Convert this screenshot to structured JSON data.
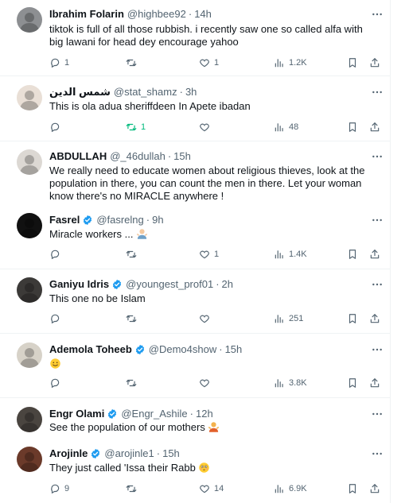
{
  "tweets": [
    {
      "name": "Ibrahim Folarin",
      "handle": "@highbee92",
      "time": "14h",
      "verified": false,
      "text": "tiktok is full of all those rubbish. i recently saw one so called alfa with big lawani for head dey encourage yahoo",
      "replies": "1",
      "retweets": "",
      "likes": "1",
      "views": "1.2K",
      "avatar_color": "#8d8f92"
    },
    {
      "name": "شمس الدين",
      "handle": "@stat_shamz",
      "time": "3h",
      "verified": false,
      "text": "This is ola adua sheriffdeen  In Apete ibadan",
      "replies": "",
      "retweets": "1",
      "likes": "",
      "views": "48",
      "avatar_color": "#e9dfd6"
    },
    {
      "name": "ABDULLAH",
      "handle": "@_46dullah",
      "time": "15h",
      "verified": false,
      "text": "We really need to educate women about religious thieves, look at the population in there, you can count the men in there. Let your woman know there's no MIRACLE anywhere !",
      "replies": "",
      "retweets": "",
      "likes": "",
      "views": "",
      "avatar_color": "#dcd8d3"
    },
    {
      "name": "Fasrel",
      "handle": "@fasrelng",
      "time": "9h",
      "verified": true,
      "text": "Miracle workers ... ",
      "emoji": "person-shrugging",
      "replies": "",
      "retweets": "",
      "likes": "1",
      "views": "1.4K",
      "avatar_color": "#111111"
    },
    {
      "name": "Ganiyu Idris",
      "handle": "@youngest_prof01",
      "time": "2h",
      "verified": true,
      "text": "This one no be Islam",
      "replies": "",
      "retweets": "",
      "likes": "",
      "views": "251",
      "avatar_color": "#3c3a38"
    },
    {
      "name": "Ademola Toheeb",
      "handle": "@Demo4show",
      "time": "15h",
      "verified": true,
      "text": "",
      "emoji": "smiling-face",
      "replies": "",
      "retweets": "",
      "likes": "",
      "views": "3.8K",
      "avatar_color": "#d7d2c8"
    },
    {
      "name": "Engr Olami",
      "handle": "@Engr_Ashile",
      "time": "12h",
      "verified": true,
      "text": "See the population of our mothers ",
      "emoji": "person-shrugging-orange",
      "replies": "",
      "retweets": "",
      "likes": "",
      "views": "",
      "avatar_color": "#4a4540"
    },
    {
      "name": "Arojinle",
      "handle": "@arojinle1",
      "time": "15h",
      "verified": true,
      "text": "They just called 'Issa their Rabb ",
      "emoji": "flushed-face",
      "replies": "9",
      "retweets": "",
      "likes": "14",
      "views": "6.9K",
      "avatar_color": "#6b3a2a"
    }
  ],
  "icons": {
    "reply": "reply-icon",
    "retweet": "retweet-icon",
    "like": "like-icon",
    "views": "views-icon",
    "bookmark": "bookmark-icon",
    "share": "share-icon",
    "more": "more-icon",
    "verified": "verified-badge-icon"
  },
  "colors": {
    "verified_blue": "#1d9bf0",
    "retweet_green": "#00ba7c",
    "muted": "#536471"
  }
}
